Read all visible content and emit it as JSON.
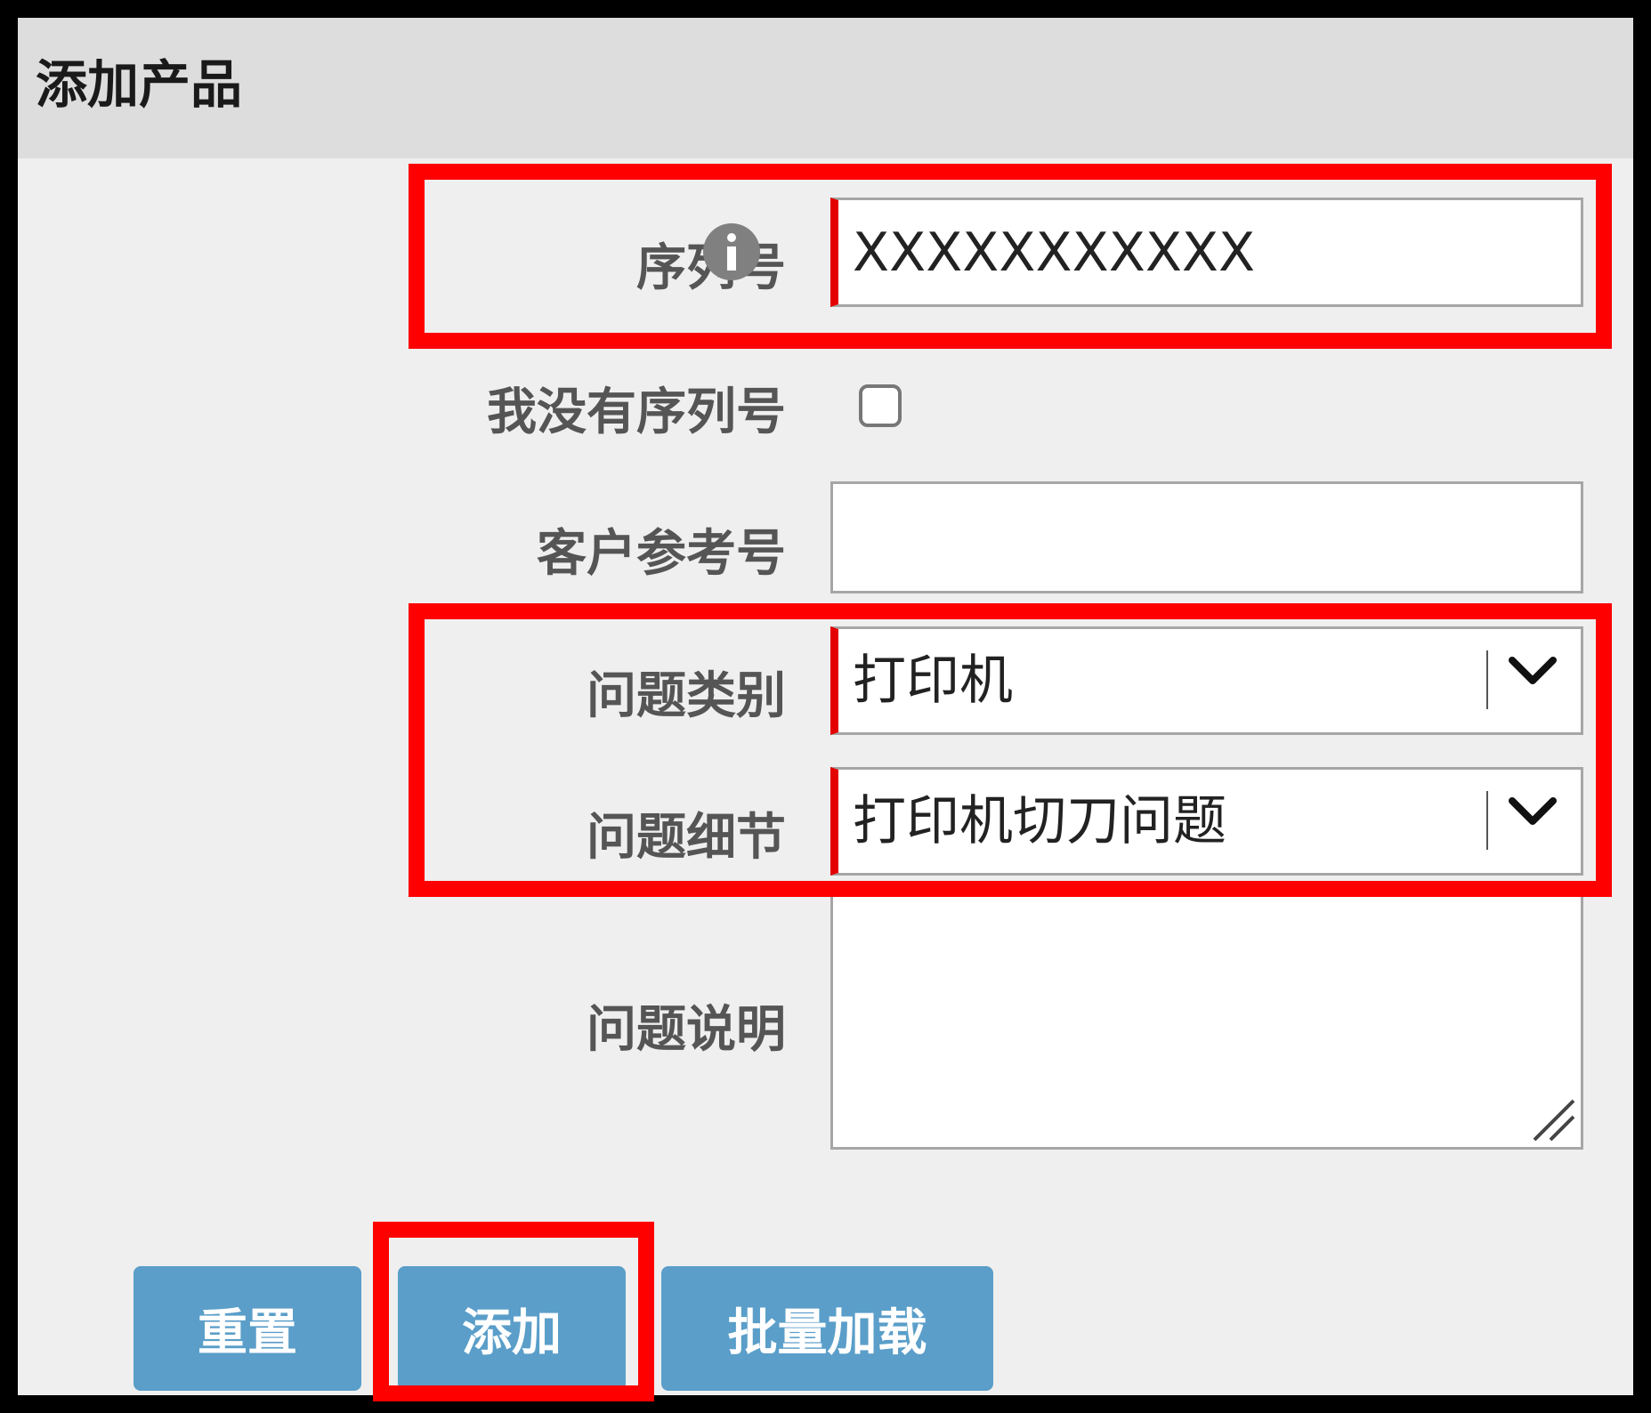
{
  "panel": {
    "title": "添加产品"
  },
  "form": {
    "serial_label": "序列号",
    "serial_value": "XXXXXXXXXXX",
    "no_serial_label": "我没有序列号",
    "no_serial_checked": false,
    "customer_ref_label": "客户参考号",
    "customer_ref_value": "",
    "issue_category_label": "问题类别",
    "issue_category_value": "打印机",
    "issue_detail_label": "问题细节",
    "issue_detail_value": "打印机切刀问题",
    "issue_description_label": "问题说明",
    "issue_description_value": ""
  },
  "buttons": {
    "reset": "重置",
    "add": "添加",
    "bulk_load": "批量加载"
  },
  "colors": {
    "accent_button": "#5a9ec9",
    "required_marker": "#e40000",
    "highlight": "#ff0000"
  },
  "icons": [
    "info-icon",
    "chevron-down-icon",
    "resize-grip-icon"
  ]
}
